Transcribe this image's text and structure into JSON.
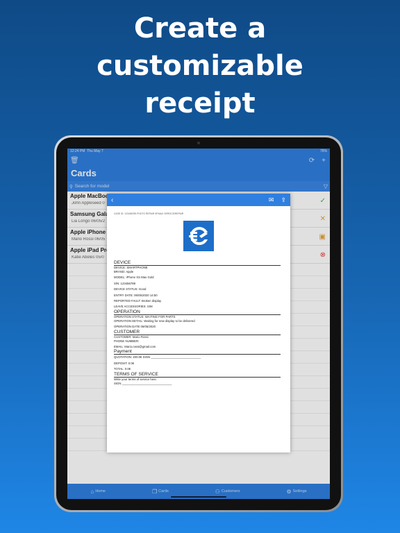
{
  "headline": [
    "Create a",
    "customizable",
    "receipt"
  ],
  "status": {
    "time": "12:24 PM",
    "date": "Thu May 7",
    "battery": "76%"
  },
  "app": {
    "title": "Cards",
    "search_placeholder": "Search for model",
    "cards": [
      {
        "title": "Apple MacBook",
        "subtitle": "John Appleseed 0",
        "status_icon": "check-circle-icon",
        "color": "#3cb84a"
      },
      {
        "title": "Samsung Gala",
        "subtitle": "Lia Longo 06/05/2",
        "status_icon": "tools-icon",
        "color": "#e6a33a"
      },
      {
        "title": "Apple iPhone",
        "subtitle": "Mario Rossi 06/05",
        "status_icon": "box-icon",
        "color": "#e6a33a"
      },
      {
        "title": "Apple iPad Pro",
        "subtitle": "Katie Abeles 05/0",
        "status_icon": "x-circle-icon",
        "color": "#e0453a"
      }
    ],
    "tabs": [
      {
        "label": "Home",
        "icon": "home-icon"
      },
      {
        "label": "Cards",
        "icon": "cards-icon"
      },
      {
        "label": "Customers",
        "icon": "person-icon"
      },
      {
        "label": "Settings",
        "icon": "gear-icon"
      }
    ]
  },
  "receipt": {
    "shop_line": "CASE ID: 123456789 PHOTO REPAIR 5F/MAX SERVICE/REPAIR",
    "sections": [
      {
        "title": "DEVICE",
        "lines": [
          "DEVICE: SMARTPHONE",
          "BRAND: Apple",
          "MODEL: iPhone XS Max Gold",
          "S/N: 123456789",
          "DEVICE STATUS: Good",
          "ENTRY DATE: 06/05/2020 14:50",
          "REPORTED FAULT: Broken display",
          "LEAVE ACCESSORIES: SIM"
        ]
      },
      {
        "title": "OPERATION",
        "lines": [
          "OPERATION STATUS: WAITING FOR PARTS",
          "OPERATION DETAIL: Waiting for new display to be delivered",
          "OPERATION DATE 06/05/2020"
        ]
      },
      {
        "title": "CUSTOMER",
        "lines": [
          "CUSTOMER: Mario Rossi",
          "PHONE NUMBER:",
          "EMAIL: Mario.rossi@gmail.com"
        ]
      },
      {
        "title": "Payment",
        "lines": [
          "QUOTATION: 200.0€    SIGN ______________________________",
          "DEPOSIT: 0.0€",
          "TOTAL: 0.0€"
        ]
      },
      {
        "title": "TERMS OF SERVICE",
        "lines": [
          "Write your terms of service here.",
          "SIGN ______________________________"
        ]
      }
    ]
  }
}
